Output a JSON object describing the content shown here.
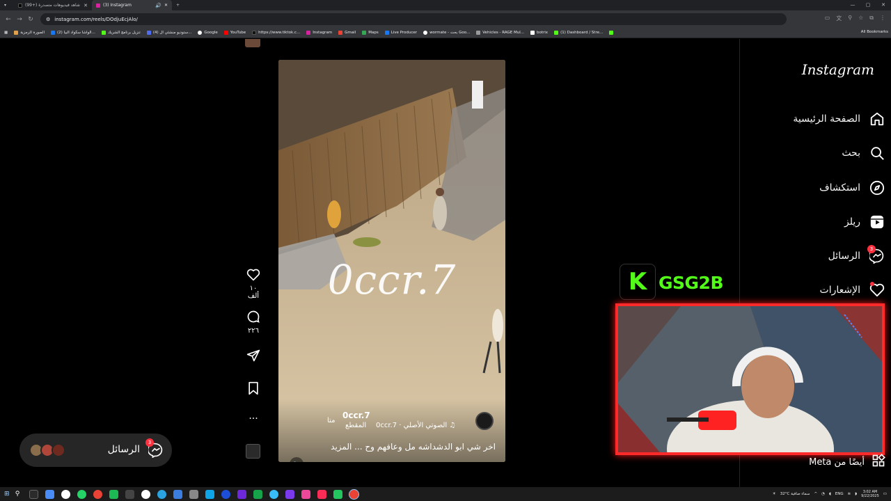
{
  "browser": {
    "tabs": [
      {
        "label": "(99+) شاهد فيديوهات متصدرة",
        "active": false
      },
      {
        "label": "(3) Instagram",
        "active": true
      }
    ],
    "url": "instagram.com/reels/DOdjuEcjAlo/",
    "bookmarks": [
      "الصورة الرمزية",
      "(2) الواشا سكواد البيا...",
      "تنزيل برنامج الشريك",
      "(4) ستوديو منشئي ال...",
      "Google",
      "YouTube",
      "https://www.tiktok.c...",
      "Instagram",
      "Gmail",
      "Maps",
      "Live Producer",
      "wormate - بحث Goo...",
      "Vehicles - RAGE Mul...",
      "botrix",
      "(1) Dashboard / Stre..."
    ],
    "all_bookmarks": "All Bookmarks"
  },
  "instagram": {
    "logo": "Instagram",
    "nav": [
      {
        "label": "الصفحة الرئيسية",
        "icon": "home-icon"
      },
      {
        "label": "بحث",
        "icon": "search-icon"
      },
      {
        "label": "استكشاف",
        "icon": "explore-icon"
      },
      {
        "label": "ريلز",
        "icon": "reels-icon"
      },
      {
        "label": "الرسائل",
        "icon": "messenger-icon",
        "badge": "3"
      },
      {
        "label": "الإشعارات",
        "icon": "heart-icon",
        "dot": true
      }
    ],
    "also_from": "أيضًا من Meta"
  },
  "reel": {
    "watermark": "0ccr.7",
    "username": "0ccr.7",
    "follow": "متا",
    "clip_label": "المقطع",
    "audio": "الصوتي الأصلي · 0ccr.7",
    "caption": "اخر شي ابو الدشداشه مل وعافهم وح ... المزيد"
  },
  "actions": {
    "likes": "١٠ ألف",
    "comments": "٢٢٦"
  },
  "messages_pill": {
    "label": "الرسائل",
    "badge": "3"
  },
  "stream": {
    "kick_mark": "K",
    "channel": "GSG2B"
  },
  "taskbar": {
    "weather": "32°C  سماء صافية",
    "lang": "ENG",
    "time": "3:02 AM",
    "date": "9/22/2025"
  },
  "colors": {
    "kick_green": "#53fc18",
    "notification_red": "#ff3040",
    "cam_border": "#ff2a2a"
  }
}
